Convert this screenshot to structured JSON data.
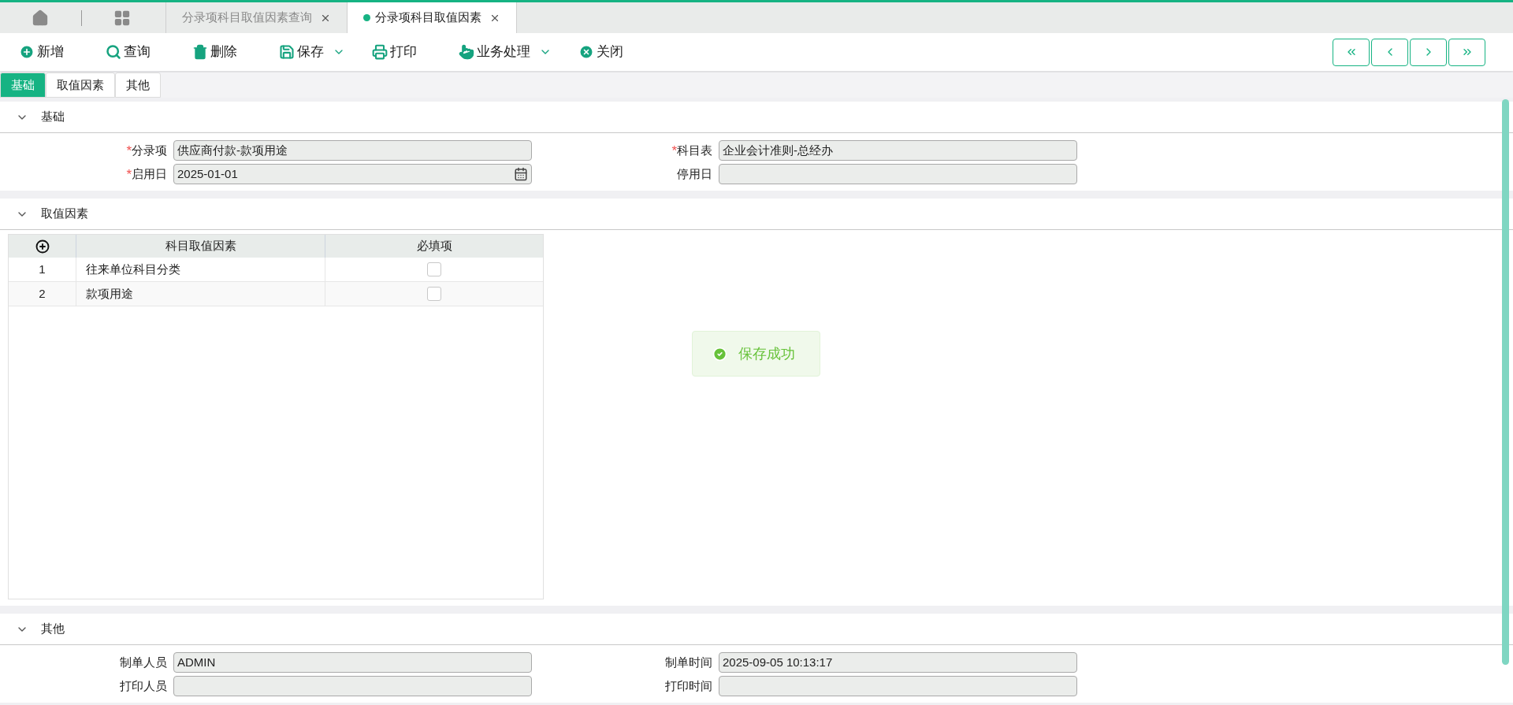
{
  "top_tabs": [
    {
      "label": "分录项科目取值因素查询",
      "selected": false
    },
    {
      "label": "分录项科目取值因素",
      "selected": true
    }
  ],
  "toolbar": [
    {
      "label": "新增",
      "kind": "plus",
      "dropdown": false
    },
    {
      "label": "查询",
      "kind": "search",
      "dropdown": false
    },
    {
      "label": "删除",
      "kind": "trash",
      "dropdown": false
    },
    {
      "label": "保存",
      "kind": "save",
      "dropdown": true
    },
    {
      "label": "打印",
      "kind": "print",
      "dropdown": false
    },
    {
      "label": "业务处理",
      "kind": "hand",
      "dropdown": true
    },
    {
      "label": "关闭",
      "kind": "close",
      "dropdown": false
    }
  ],
  "section_tabs": [
    {
      "label": "基础",
      "selected": true
    },
    {
      "label": "取值因素",
      "selected": false
    },
    {
      "label": "其他",
      "selected": false
    }
  ],
  "basic_section": {
    "title": "基础",
    "expanded": true,
    "fields": [
      {
        "marker": "*",
        "label": "分录项",
        "value": "供应商付款-款项用途"
      },
      {
        "marker": "*",
        "label": "科目表",
        "value": "企业会计准则-总经办"
      },
      {
        "marker": "*",
        "label": "启用日",
        "value": "2025-01-01",
        "kind": "date"
      },
      {
        "label": "停用日"
      }
    ]
  },
  "factor_section": {
    "title": "取值因素",
    "expanded": true,
    "table": {
      "columns": [
        "科目取值因素",
        "必填项"
      ],
      "rows": [
        {
          "index": "1",
          "factor": "往来单位科目分类",
          "required": false
        },
        {
          "index": "2",
          "factor": "款项用途",
          "required": false
        }
      ]
    }
  },
  "other_section": {
    "title": "其他",
    "expanded": true,
    "fields": [
      {
        "label": "制单人员",
        "value": "ADMIN"
      },
      {
        "label": "制单时间",
        "value": "2025-09-05 10:13:17"
      },
      {
        "label": "打印人员"
      },
      {
        "label": "打印时间"
      }
    ]
  },
  "toast": {
    "message": "保存成功"
  }
}
